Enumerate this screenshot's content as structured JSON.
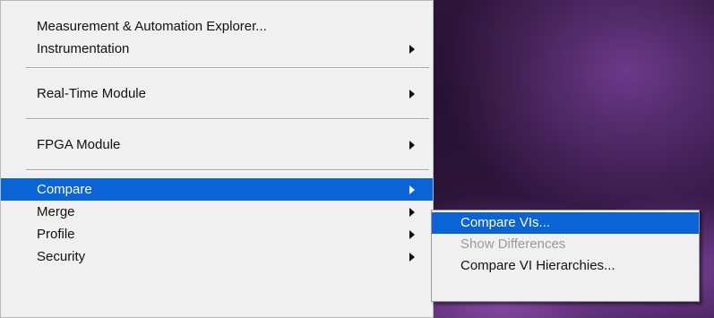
{
  "main_menu": {
    "items": [
      {
        "label": "Measurement & Automation Explorer...",
        "has_submenu": false
      },
      {
        "label": "Instrumentation",
        "has_submenu": true
      },
      {
        "label": "Real-Time Module",
        "has_submenu": true
      },
      {
        "label": "FPGA Module",
        "has_submenu": true
      },
      {
        "label": "Compare",
        "has_submenu": true,
        "highlighted": true
      },
      {
        "label": "Merge",
        "has_submenu": true
      },
      {
        "label": "Profile",
        "has_submenu": true
      },
      {
        "label": "Security",
        "has_submenu": true
      }
    ]
  },
  "compare_submenu": {
    "items": [
      {
        "label": "Compare VIs...",
        "highlighted": true,
        "enabled": true
      },
      {
        "label": "Show Differences",
        "enabled": false
      },
      {
        "label": "Compare VI Hierarchies...",
        "enabled": true
      }
    ]
  },
  "colors": {
    "menu_background": "#f0f0f0",
    "highlight": "#0a64d6",
    "disabled_text": "#9a9a9a"
  },
  "icons": {
    "submenu_arrow": "chevron-right-icon"
  }
}
